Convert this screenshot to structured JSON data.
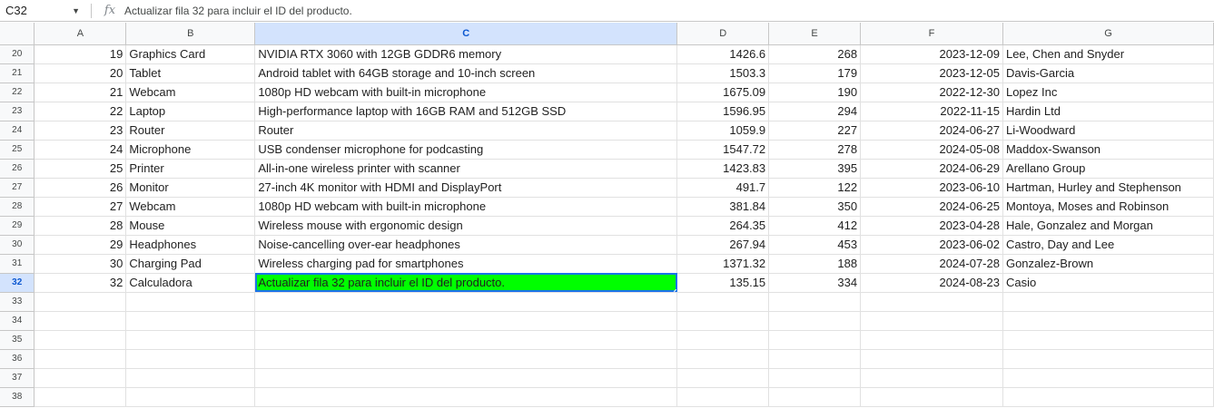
{
  "name_box": {
    "value": "C32",
    "caret_icon": "dropdown-caret-icon"
  },
  "formula_bar": {
    "icon": "fx-icon",
    "icon_label": "fx",
    "text": "Actualizar fila 32 para incluir el ID del producto."
  },
  "colors": {
    "selected_fill": "#00ff00",
    "selection_border": "#1a73e8",
    "active_header": "#d3e3fd"
  },
  "active_cell": {
    "column": "C",
    "row": "32"
  },
  "columns": [
    "A",
    "B",
    "C",
    "D",
    "E",
    "F",
    "G"
  ],
  "rows": [
    {
      "num": "20",
      "cells": [
        "19",
        "Graphics Card",
        "NVIDIA RTX 3060 with 12GB GDDR6 memory",
        "1426.6",
        "268",
        "2023-12-09",
        "Lee, Chen and Snyder"
      ]
    },
    {
      "num": "21",
      "cells": [
        "20",
        "Tablet",
        "Android tablet with 64GB storage and 10-inch screen",
        "1503.3",
        "179",
        "2023-12-05",
        "Davis-Garcia"
      ]
    },
    {
      "num": "22",
      "cells": [
        "21",
        "Webcam",
        "1080p HD webcam with built-in microphone",
        "1675.09",
        "190",
        "2022-12-30",
        "Lopez Inc"
      ]
    },
    {
      "num": "23",
      "cells": [
        "22",
        "Laptop",
        "High-performance laptop with 16GB RAM and 512GB SSD",
        "1596.95",
        "294",
        "2022-11-15",
        "Hardin Ltd"
      ]
    },
    {
      "num": "24",
      "cells": [
        "23",
        "Router",
        "Router",
        "1059.9",
        "227",
        "2024-06-27",
        "Li-Woodward"
      ]
    },
    {
      "num": "25",
      "cells": [
        "24",
        "Microphone",
        "USB condenser microphone for podcasting",
        "1547.72",
        "278",
        "2024-05-08",
        "Maddox-Swanson"
      ]
    },
    {
      "num": "26",
      "cells": [
        "25",
        "Printer",
        "All-in-one wireless printer with scanner",
        "1423.83",
        "395",
        "2024-06-29",
        "Arellano Group"
      ]
    },
    {
      "num": "27",
      "cells": [
        "26",
        "Monitor",
        "27-inch 4K monitor with HDMI and DisplayPort",
        "491.7",
        "122",
        "2023-06-10",
        "Hartman, Hurley and Stephenson"
      ]
    },
    {
      "num": "28",
      "cells": [
        "27",
        "Webcam",
        "1080p HD webcam with built-in microphone",
        "381.84",
        "350",
        "2024-06-25",
        "Montoya, Moses and Robinson"
      ]
    },
    {
      "num": "29",
      "cells": [
        "28",
        "Mouse",
        "Wireless mouse with ergonomic design",
        "264.35",
        "412",
        "2023-04-28",
        "Hale, Gonzalez and Morgan"
      ]
    },
    {
      "num": "30",
      "cells": [
        "29",
        "Headphones",
        "Noise-cancelling over-ear headphones",
        "267.94",
        "453",
        "2023-06-02",
        "Castro, Day and Lee"
      ]
    },
    {
      "num": "31",
      "cells": [
        "30",
        "Charging Pad",
        "Wireless charging pad for smartphones",
        "1371.32",
        "188",
        "2024-07-28",
        "Gonzalez-Brown"
      ]
    },
    {
      "num": "32",
      "cells": [
        "32",
        "Calculadora",
        "Actualizar fila 32 para incluir el ID del producto.",
        "135.15",
        "334",
        "2024-08-23",
        "Casio"
      ]
    },
    {
      "num": "33",
      "cells": [
        "",
        "",
        "",
        "",
        "",
        "",
        ""
      ]
    },
    {
      "num": "34",
      "cells": [
        "",
        "",
        "",
        "",
        "",
        "",
        ""
      ]
    },
    {
      "num": "35",
      "cells": [
        "",
        "",
        "",
        "",
        "",
        "",
        ""
      ]
    },
    {
      "num": "36",
      "cells": [
        "",
        "",
        "",
        "",
        "",
        "",
        ""
      ]
    },
    {
      "num": "37",
      "cells": [
        "",
        "",
        "",
        "",
        "",
        "",
        ""
      ]
    },
    {
      "num": "38",
      "cells": [
        "",
        "",
        "",
        "",
        "",
        "",
        ""
      ]
    }
  ]
}
